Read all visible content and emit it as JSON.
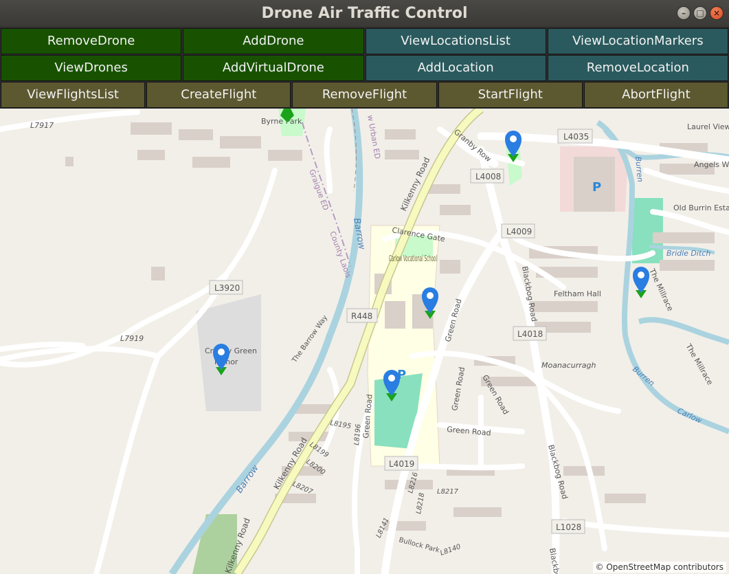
{
  "window": {
    "title": "Drone Air Traffic Control",
    "controls": [
      "minimize",
      "maximize",
      "close"
    ]
  },
  "toolbar": {
    "row1": [
      {
        "label": "RemoveDrone",
        "color": "#185200"
      },
      {
        "label": "AddDrone",
        "color": "#185200"
      },
      {
        "label": "ViewLocationsList",
        "color": "#2a5a5e"
      },
      {
        "label": "ViewLocationMarkers",
        "color": "#2a5a5e"
      }
    ],
    "row2": [
      {
        "label": "ViewDrones",
        "color": "#185200"
      },
      {
        "label": "AddVirtualDrone",
        "color": "#185200"
      },
      {
        "label": "AddLocation",
        "color": "#2a5a5e"
      },
      {
        "label": "RemoveLocation",
        "color": "#2a5a5e"
      }
    ],
    "row3": [
      {
        "label": "ViewFlightsList",
        "color": "#5c5830"
      },
      {
        "label": "CreateFlight",
        "color": "#5c5830"
      },
      {
        "label": "RemoveFlight",
        "color": "#5c5830"
      },
      {
        "label": "StartFlight",
        "color": "#5c5830"
      },
      {
        "label": "AbortFlight",
        "color": "#5c5830"
      }
    ]
  },
  "map": {
    "road_labels": {
      "l7917": "L7917",
      "l4035": "L4035",
      "laurel_view": "Laurel View",
      "granby_row": "Granby Row",
      "l4008": "L4008",
      "angels_way": "Angels Way",
      "kilkenny_road_top": "Kilkenny Road",
      "graigue_ed": "Graigue ED",
      "county_laois": "County Laois",
      "barrow_upper": "Barrow",
      "urban_ed": "w Urban ED",
      "byrne_park": "Byrne Park",
      "l4009": "L4009",
      "clarence_gate": "Clarence Gate",
      "carlow_vocational_school": "Carlow Vocational School",
      "old_burrin_estate": "Old Burrin Estate",
      "bridle_ditch": "Bridle Ditch",
      "burren_upper": "Burren",
      "l3920": "L3920",
      "feltham_hall": "Feltham Hall",
      "blackbog_road_upper": "Blackbog Road",
      "the_millrace_upper": "The Millrace",
      "r448": "R448",
      "green_road_upper": "Green Road",
      "l4018": "L4018",
      "l7919": "L7919",
      "croppy_green": "Croppy Green",
      "manor": "Manor",
      "the_barrow_way": "The Barrow Way",
      "moanacurragh": "Moanacurragh",
      "the_millrace_lower": "The Millrace",
      "burren_lower": "Burren",
      "carlow_label": "Carlow",
      "green_road_right": "Green Road",
      "green_road_mid": "Green Road",
      "green_road_lower": "Green Road",
      "green_road_vert": "Green Road",
      "l8195": "L8195",
      "l8196": "L8196",
      "l8199": "L8199",
      "l8200": "L8200",
      "l8207": "L8207",
      "kilkenny_road_lower": "Kilkenny Road",
      "barrow_lower": "Barrow",
      "l4019": "L4019",
      "l8216": "L8216",
      "l8218": "L8218",
      "l8217": "L8217",
      "blackbog_road_lower": "Blackbog Road",
      "l1028": "L1028",
      "l8141": "L8141",
      "bullock_park": "Bullock Park",
      "l8140": "L8140",
      "kilkenny_road_bottom": "Kilkenny Road",
      "blackbog_bottom": "Blackbog"
    },
    "markers": [
      {
        "name": "marker-byrne-park",
        "icon": "map-pin-icon"
      },
      {
        "name": "marker-granby-row",
        "icon": "map-pin-icon"
      },
      {
        "name": "marker-millrace",
        "icon": "map-pin-icon"
      },
      {
        "name": "marker-vocational-school",
        "icon": "map-pin-icon"
      },
      {
        "name": "marker-croppy-green",
        "icon": "map-pin-icon"
      },
      {
        "name": "marker-green-road",
        "icon": "map-pin-icon"
      }
    ],
    "parking_symbol": "P",
    "attribution": "© OpenStreetMap contributors",
    "colors": {
      "background": "#f2efe9",
      "river": "#aad3df",
      "major_road": "#f7fabf",
      "school_area": "#ffffe5",
      "park": "#c8facc",
      "pitch": "#88e0be",
      "marker_blue": "#2a7de1",
      "marker_green": "#1aa31a"
    }
  }
}
